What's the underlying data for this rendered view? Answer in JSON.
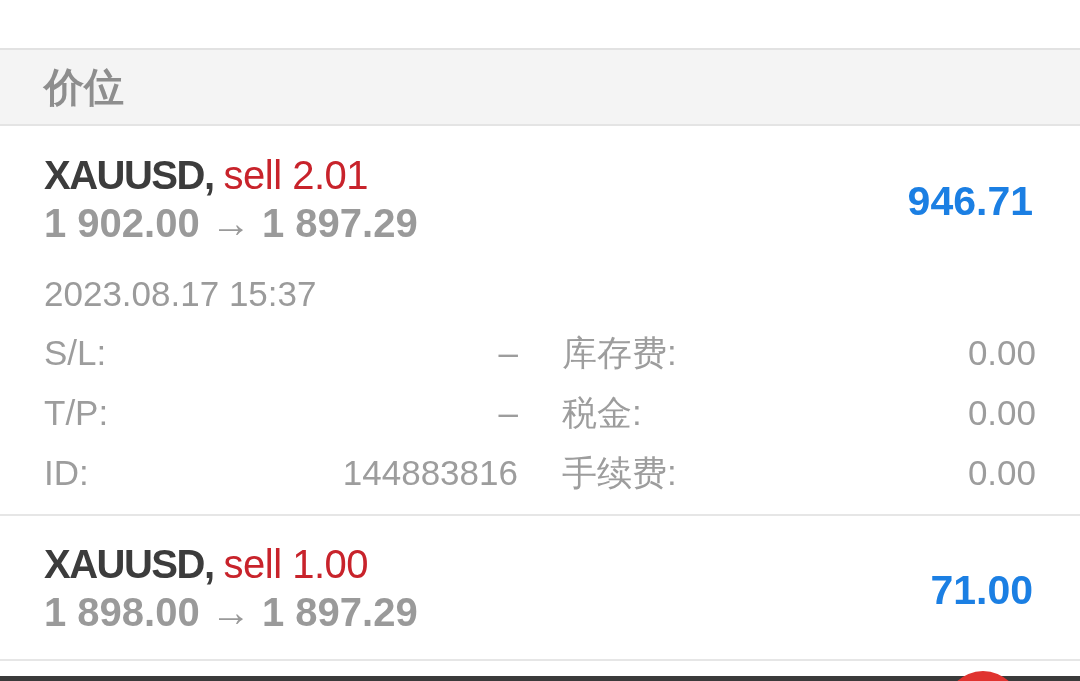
{
  "section_header": "价位",
  "positions": [
    {
      "symbol": "XAUUSD,",
      "side": "sell 2.01",
      "prices": "1 902.00 → 1 897.29",
      "profit": "946.71",
      "time": "2023.08.17 15:37",
      "details": [
        {
          "label": "S/L:",
          "value": "–"
        },
        {
          "label": "库存费:",
          "value": "0.00"
        },
        {
          "label": "T/P:",
          "value": "–"
        },
        {
          "label": "税金:",
          "value": "0.00"
        },
        {
          "label": "ID:",
          "value": "144883816"
        },
        {
          "label": "手续费:",
          "value": "0.00"
        }
      ]
    },
    {
      "symbol": "XAUUSD,",
      "side": "sell 1.00",
      "prices": "1 898.00 → 1 897.29",
      "profit": "71.00"
    }
  ]
}
